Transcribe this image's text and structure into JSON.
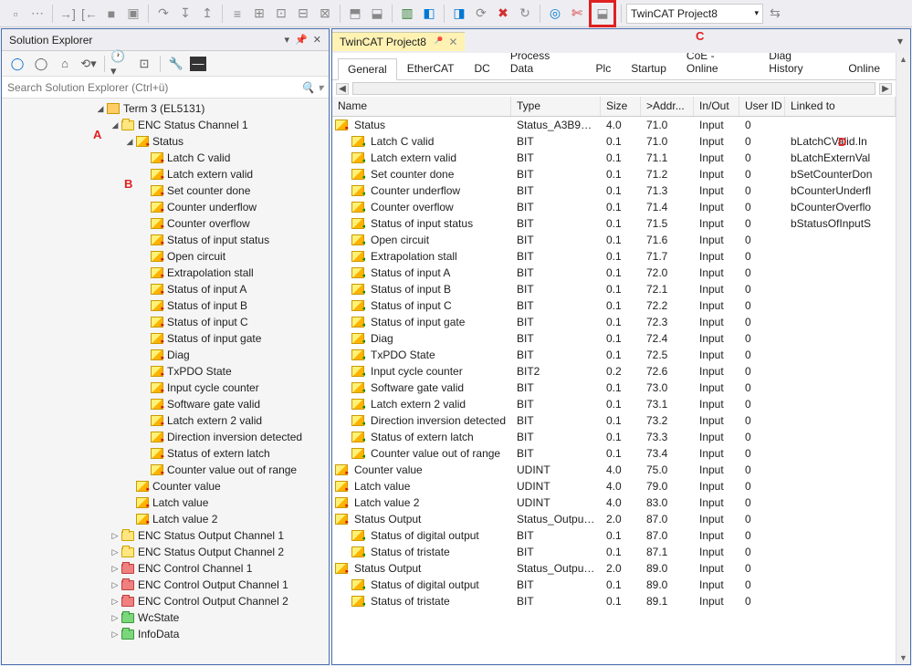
{
  "toolbar": {
    "project_dropdown": "TwinCAT Project8"
  },
  "labels": {
    "a": "A",
    "b": "B",
    "c": "C",
    "d": "D"
  },
  "solution_explorer": {
    "title": "Solution Explorer",
    "search_placeholder": "Search Solution Explorer (Ctrl+ü)",
    "root": "Term 3 (EL5131)",
    "enc_status_ch1": "ENC Status Channel 1",
    "status": "Status",
    "status_children": [
      "Latch C valid",
      "Latch extern valid",
      "Set counter done",
      "Counter underflow",
      "Counter overflow",
      "Status of input status",
      "Open circuit",
      "Extrapolation stall",
      "Status of input A",
      "Status of input B",
      "Status of input C",
      "Status of input gate",
      "Diag",
      "TxPDO State",
      "Input cycle counter",
      "Software gate valid",
      "Latch extern 2 valid",
      "Direction inversion detected",
      "Status of extern latch",
      "Counter value out of range"
    ],
    "after_status": [
      "Counter value",
      "Latch value",
      "Latch value 2"
    ],
    "siblings": [
      {
        "label": "ENC Status Output Channel 1",
        "color": "yel"
      },
      {
        "label": "ENC Status Output Channel 2",
        "color": "yel"
      },
      {
        "label": "ENC Control Channel 1",
        "color": "red"
      },
      {
        "label": "ENC Control Output Channel 1",
        "color": "red"
      },
      {
        "label": "ENC Control Output Channel 2",
        "color": "red"
      },
      {
        "label": "WcState",
        "color": "grn"
      },
      {
        "label": "InfoData",
        "color": "grn"
      }
    ]
  },
  "document": {
    "tab_title": "TwinCAT Project8",
    "sub_tabs": [
      "General",
      "EtherCAT",
      "DC",
      "Process Data",
      "Plc",
      "Startup",
      "CoE - Online",
      "Diag History",
      "Online"
    ],
    "active_tab": "General",
    "columns": [
      "Name",
      "Type",
      "Size",
      ">Addr...",
      "In/Out",
      "User ID",
      "Linked to"
    ],
    "rows": [
      {
        "i": 0,
        "name": "Status",
        "type": "Status_A3B90...",
        "size": "4.0",
        "addr": "71.0",
        "io": "Input",
        "uid": "0",
        "link": ""
      },
      {
        "i": 1,
        "name": "Latch C valid",
        "type": "BIT",
        "size": "0.1",
        "addr": "71.0",
        "io": "Input",
        "uid": "0",
        "link": "bLatchCValid.In"
      },
      {
        "i": 1,
        "name": "Latch extern valid",
        "type": "BIT",
        "size": "0.1",
        "addr": "71.1",
        "io": "Input",
        "uid": "0",
        "link": "bLatchExternVal"
      },
      {
        "i": 1,
        "name": "Set counter done",
        "type": "BIT",
        "size": "0.1",
        "addr": "71.2",
        "io": "Input",
        "uid": "0",
        "link": "bSetCounterDon"
      },
      {
        "i": 1,
        "name": "Counter underflow",
        "type": "BIT",
        "size": "0.1",
        "addr": "71.3",
        "io": "Input",
        "uid": "0",
        "link": "bCounterUnderfl"
      },
      {
        "i": 1,
        "name": "Counter overflow",
        "type": "BIT",
        "size": "0.1",
        "addr": "71.4",
        "io": "Input",
        "uid": "0",
        "link": "bCounterOverflo"
      },
      {
        "i": 1,
        "name": "Status of input status",
        "type": "BIT",
        "size": "0.1",
        "addr": "71.5",
        "io": "Input",
        "uid": "0",
        "link": "bStatusOfInputS"
      },
      {
        "i": 1,
        "name": "Open circuit",
        "type": "BIT",
        "size": "0.1",
        "addr": "71.6",
        "io": "Input",
        "uid": "0",
        "link": ""
      },
      {
        "i": 1,
        "name": "Extrapolation stall",
        "type": "BIT",
        "size": "0.1",
        "addr": "71.7",
        "io": "Input",
        "uid": "0",
        "link": ""
      },
      {
        "i": 1,
        "name": "Status of input A",
        "type": "BIT",
        "size": "0.1",
        "addr": "72.0",
        "io": "Input",
        "uid": "0",
        "link": ""
      },
      {
        "i": 1,
        "name": "Status of input B",
        "type": "BIT",
        "size": "0.1",
        "addr": "72.1",
        "io": "Input",
        "uid": "0",
        "link": ""
      },
      {
        "i": 1,
        "name": "Status of input C",
        "type": "BIT",
        "size": "0.1",
        "addr": "72.2",
        "io": "Input",
        "uid": "0",
        "link": ""
      },
      {
        "i": 1,
        "name": "Status of input gate",
        "type": "BIT",
        "size": "0.1",
        "addr": "72.3",
        "io": "Input",
        "uid": "0",
        "link": ""
      },
      {
        "i": 1,
        "name": "Diag",
        "type": "BIT",
        "size": "0.1",
        "addr": "72.4",
        "io": "Input",
        "uid": "0",
        "link": ""
      },
      {
        "i": 1,
        "name": "TxPDO State",
        "type": "BIT",
        "size": "0.1",
        "addr": "72.5",
        "io": "Input",
        "uid": "0",
        "link": ""
      },
      {
        "i": 1,
        "name": "Input cycle counter",
        "type": "BIT2",
        "size": "0.2",
        "addr": "72.6",
        "io": "Input",
        "uid": "0",
        "link": ""
      },
      {
        "i": 1,
        "name": "Software gate valid",
        "type": "BIT",
        "size": "0.1",
        "addr": "73.0",
        "io": "Input",
        "uid": "0",
        "link": ""
      },
      {
        "i": 1,
        "name": "Latch extern 2 valid",
        "type": "BIT",
        "size": "0.1",
        "addr": "73.1",
        "io": "Input",
        "uid": "0",
        "link": ""
      },
      {
        "i": 1,
        "name": "Direction inversion detected",
        "type": "BIT",
        "size": "0.1",
        "addr": "73.2",
        "io": "Input",
        "uid": "0",
        "link": ""
      },
      {
        "i": 1,
        "name": "Status of extern latch",
        "type": "BIT",
        "size": "0.1",
        "addr": "73.3",
        "io": "Input",
        "uid": "0",
        "link": ""
      },
      {
        "i": 1,
        "name": "Counter value out of range",
        "type": "BIT",
        "size": "0.1",
        "addr": "73.4",
        "io": "Input",
        "uid": "0",
        "link": ""
      },
      {
        "i": 0,
        "name": "Counter value",
        "type": "UDINT",
        "size": "4.0",
        "addr": "75.0",
        "io": "Input",
        "uid": "0",
        "link": ""
      },
      {
        "i": 0,
        "name": "Latch value",
        "type": "UDINT",
        "size": "4.0",
        "addr": "79.0",
        "io": "Input",
        "uid": "0",
        "link": ""
      },
      {
        "i": 0,
        "name": "Latch value 2",
        "type": "UDINT",
        "size": "4.0",
        "addr": "83.0",
        "io": "Input",
        "uid": "0",
        "link": ""
      },
      {
        "i": 0,
        "name": "Status Output",
        "type": "Status_Output...",
        "size": "2.0",
        "addr": "87.0",
        "io": "Input",
        "uid": "0",
        "link": ""
      },
      {
        "i": 1,
        "name": "Status of digital output",
        "type": "BIT",
        "size": "0.1",
        "addr": "87.0",
        "io": "Input",
        "uid": "0",
        "link": ""
      },
      {
        "i": 1,
        "name": "Status of tristate",
        "type": "BIT",
        "size": "0.1",
        "addr": "87.1",
        "io": "Input",
        "uid": "0",
        "link": ""
      },
      {
        "i": 0,
        "name": "Status Output",
        "type": "Status_Output...",
        "size": "2.0",
        "addr": "89.0",
        "io": "Input",
        "uid": "0",
        "link": ""
      },
      {
        "i": 1,
        "name": "Status of digital output",
        "type": "BIT",
        "size": "0.1",
        "addr": "89.0",
        "io": "Input",
        "uid": "0",
        "link": ""
      },
      {
        "i": 1,
        "name": "Status of tristate",
        "type": "BIT",
        "size": "0.1",
        "addr": "89.1",
        "io": "Input",
        "uid": "0",
        "link": ""
      }
    ]
  }
}
